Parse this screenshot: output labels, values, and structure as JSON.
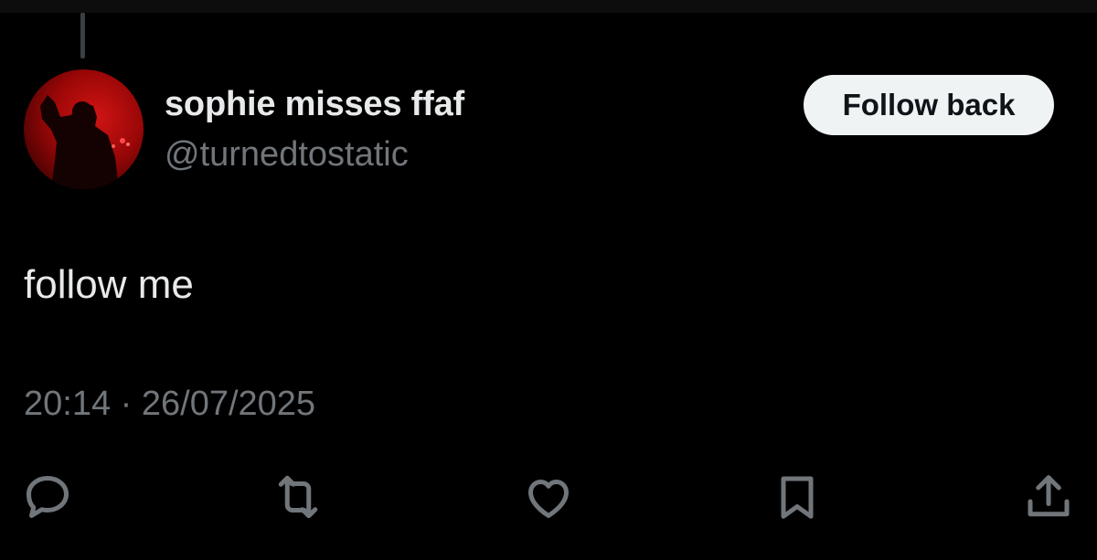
{
  "tweet": {
    "author": {
      "display_name": "sophie misses ffaf",
      "handle": "@turnedtostatic"
    },
    "follow_button_label": "Follow back",
    "text": "follow me",
    "time": "20:14",
    "separator": "·",
    "date": "26/07/2025"
  },
  "actions": [
    {
      "name": "reply-icon"
    },
    {
      "name": "retweet-icon"
    },
    {
      "name": "like-icon"
    },
    {
      "name": "bookmark-icon"
    },
    {
      "name": "share-icon"
    }
  ],
  "colors": {
    "background": "#000000",
    "primary_text": "#e7e9ea",
    "secondary_text": "#71767b",
    "follow_button_bg": "#eff3f4",
    "avatar_accent": "#c80f0f"
  }
}
